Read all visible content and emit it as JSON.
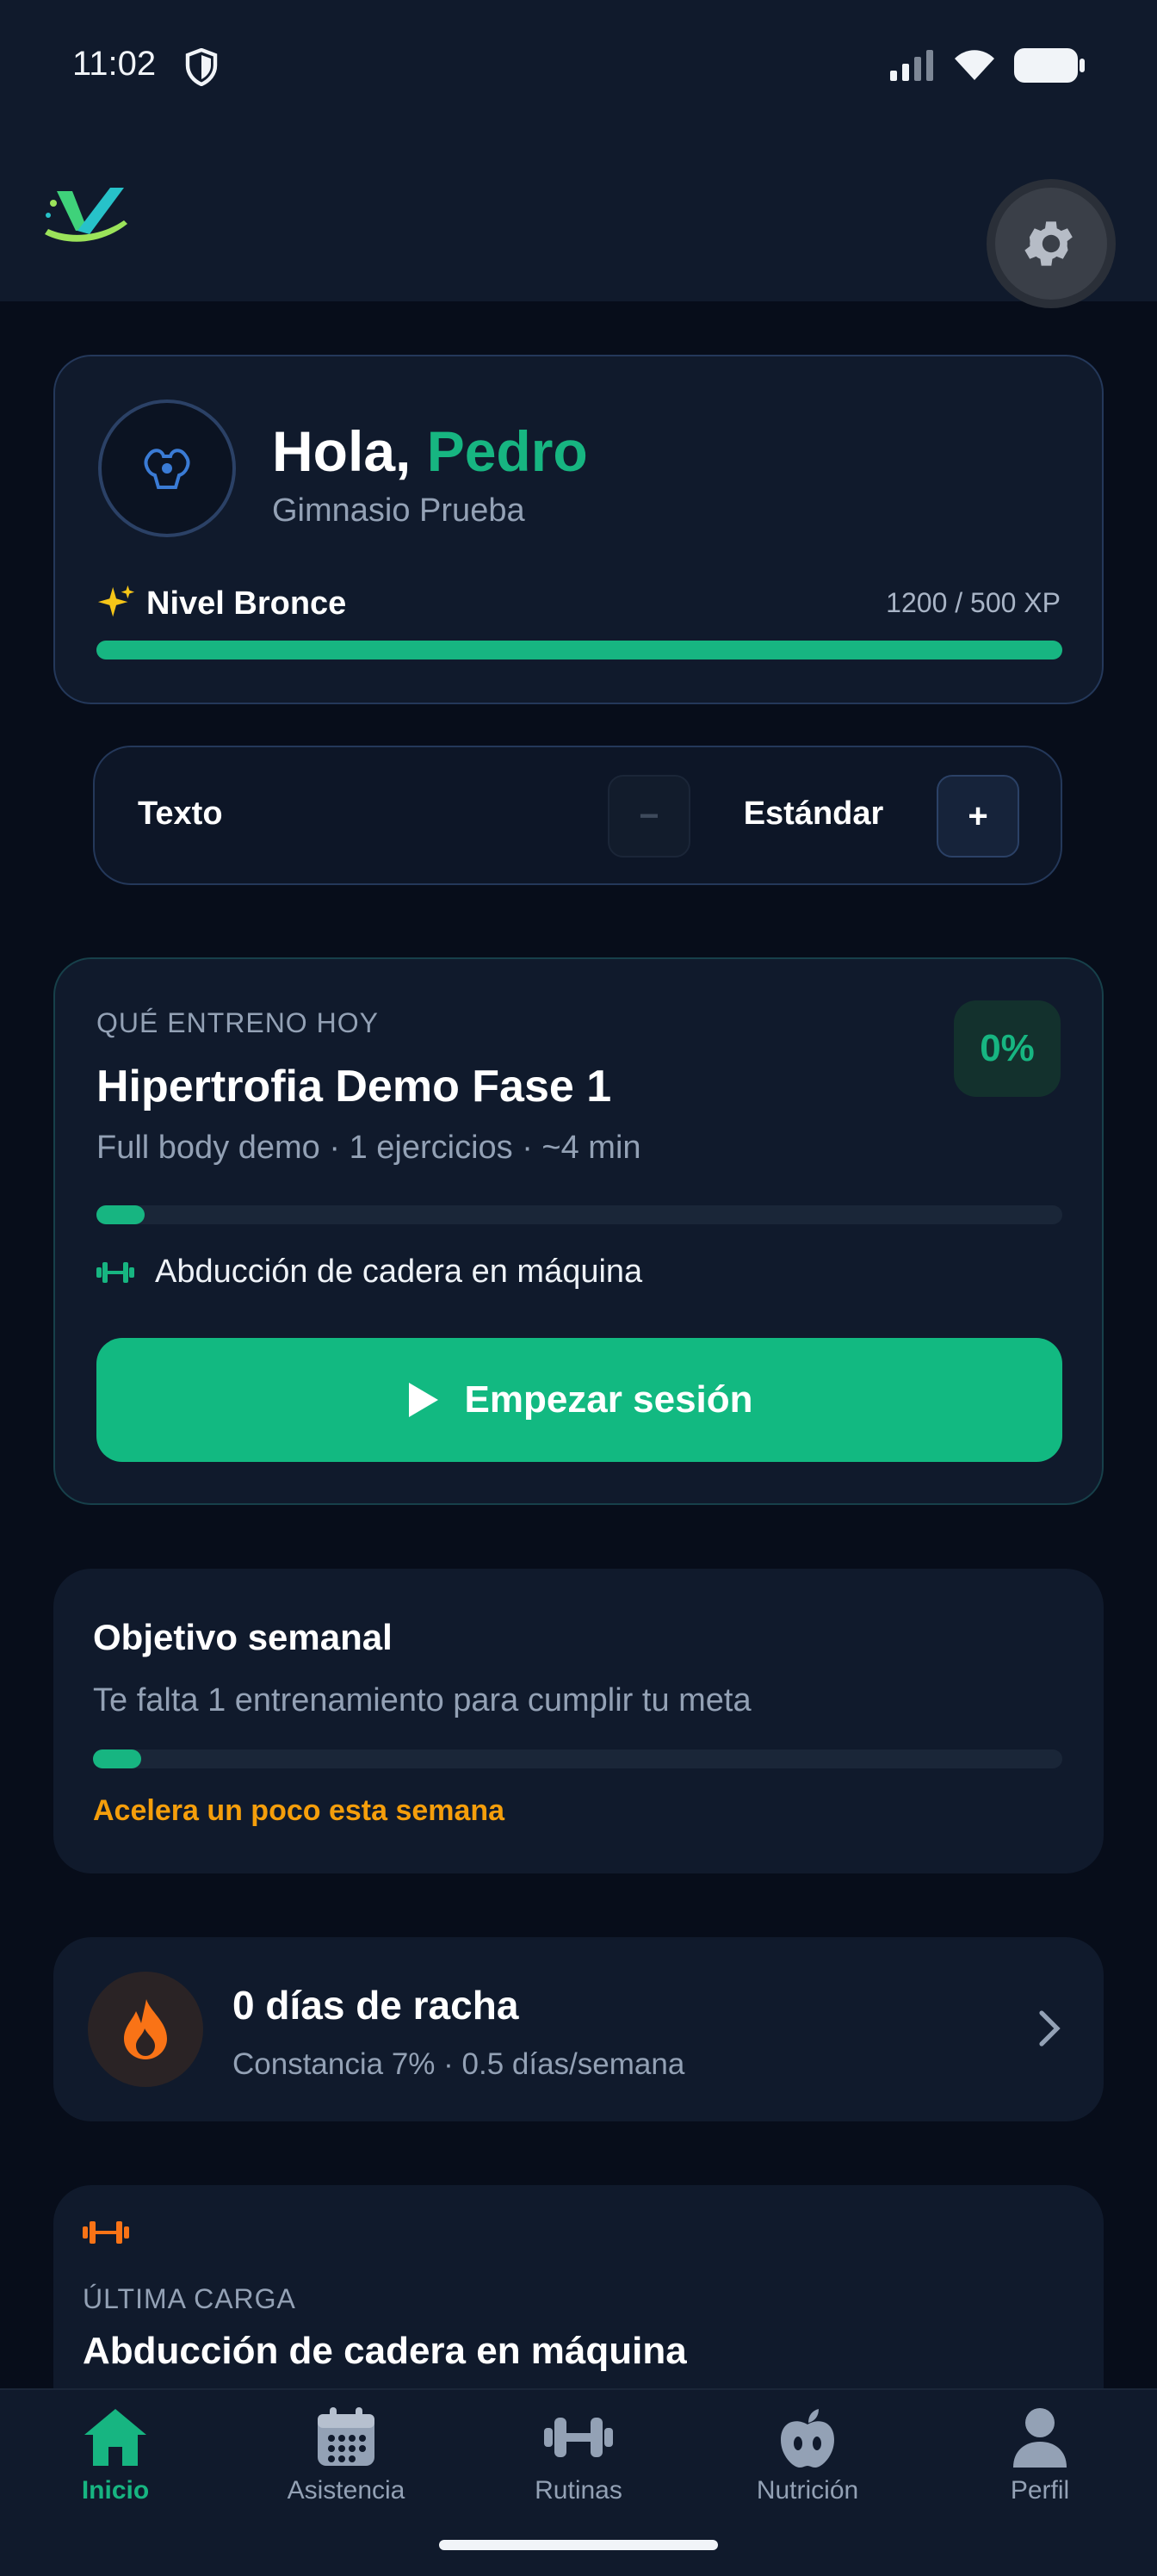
{
  "status_bar": {
    "time": "11:02"
  },
  "greeting": {
    "hello": "Hola,",
    "name": "Pedro",
    "gym": "Gimnasio Prueba",
    "level_label": "Nivel Bronce",
    "xp_text": "1200 / 500 XP",
    "xp_progress_percent": 100
  },
  "text_size": {
    "label": "Texto",
    "value": "Estándar",
    "minus_label": "−",
    "plus_label": "+"
  },
  "workout": {
    "kicker": "QUÉ ENTRENO HOY",
    "title": "Hipertrofia Demo Fase 1",
    "subtitle": "Full body demo · 1 ejercicios · ~4 min",
    "percent": "0%",
    "progress_percent": 0,
    "exercise": "Abducción de cadera en máquina",
    "start_label": "Empezar sesión"
  },
  "weekly_goal": {
    "title": "Objetivo semanal",
    "subtitle": "Te falta 1 entrenamiento para cumplir tu meta",
    "warning": "Acelera un poco esta semana",
    "progress_percent": 0
  },
  "streak": {
    "title": "0 días de racha",
    "subtitle": "Constancia 7% · 0.5 días/semana"
  },
  "last_load": {
    "kicker": "ÚLTIMA CARGA",
    "title": "Abducción de cadera en máquina"
  },
  "nav": {
    "items": [
      {
        "label": "Inicio",
        "icon": "home-icon",
        "active": true
      },
      {
        "label": "Asistencia",
        "icon": "calendar-icon",
        "active": false
      },
      {
        "label": "Rutinas",
        "icon": "dumbbell-icon",
        "active": false
      },
      {
        "label": "Nutrición",
        "icon": "apple-icon",
        "active": false
      },
      {
        "label": "Perfil",
        "icon": "user-icon",
        "active": false
      }
    ]
  },
  "colors": {
    "accent": "#17b581",
    "warning": "#f59e0b",
    "background": "#070d1a",
    "card": "#101a2c",
    "streak_flame": "#f97316"
  }
}
